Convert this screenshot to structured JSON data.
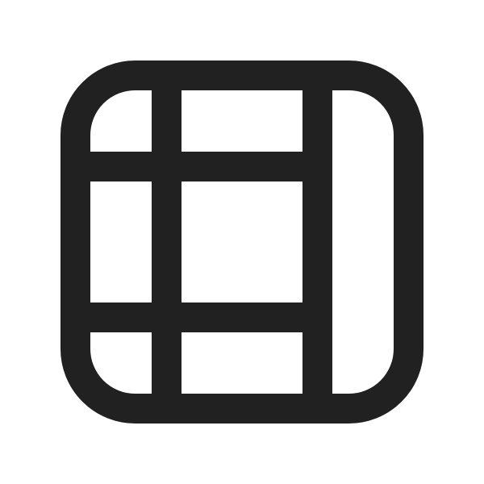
{
  "icon": {
    "name": "table-freeze-column-row-icon",
    "stroke_color": "#212121",
    "background_color": "#ffffff"
  }
}
